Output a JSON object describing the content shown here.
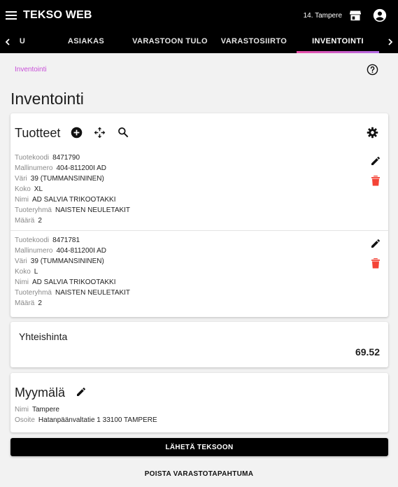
{
  "app": {
    "title": "TEKSO WEB",
    "store_name": "14. Tampere",
    "icons": {
      "menu": "menu-icon",
      "store": "storefront-icon",
      "account": "account-circle-icon"
    }
  },
  "tabs": {
    "partial": "U",
    "items": [
      {
        "label": "ASIAKAS",
        "active": false
      },
      {
        "label": "VARASTOON TULO",
        "active": false
      },
      {
        "label": "VARASTOSIIRTO",
        "active": false
      },
      {
        "label": "INVENTOINTI",
        "active": true
      }
    ]
  },
  "breadcrumb": "Inventointi",
  "page_title": "Inventointi",
  "products": {
    "title": "Tuotteet",
    "icons": [
      "add-circle-icon",
      "move-icon",
      "search-icon",
      "settings-icon"
    ],
    "items": [
      {
        "code_label": "Tuotekoodi",
        "code": "8471790",
        "model_label": "Mallinumero",
        "model": "404-811200I AD",
        "color_label": "Väri",
        "color": "39 (TUMMANSININEN)",
        "size_label": "Koko",
        "size": "XL",
        "name_label": "Nimi",
        "name": "AD SALVIA TRIKOOTAKKI",
        "group_label": "Tuoteryhmä",
        "group": "NAISTEN NEULETAKIT",
        "qty_label": "Määrä",
        "qty": "2"
      },
      {
        "code_label": "Tuotekoodi",
        "code": "8471781",
        "model_label": "Mallinumero",
        "model": "404-811200I AD",
        "color_label": "Väri",
        "color": "39 (TUMMANSININEN)",
        "size_label": "Koko",
        "size": "L",
        "name_label": "Nimi",
        "name": "AD SALVIA TRIKOOTAKKI",
        "group_label": "Tuoteryhmä",
        "group": "NAISTEN NEULETAKIT",
        "qty_label": "Määrä",
        "qty": "2"
      }
    ]
  },
  "total": {
    "label": "Yhteishinta",
    "value": "69.52"
  },
  "store": {
    "title": "Myymälä",
    "name_label": "Nimi",
    "name": "Tampere",
    "address_label": "Osoite",
    "address": "Hatanpäänvaltatie 1 33100 TAMPERE"
  },
  "actions": {
    "send": "LÄHETÄ TEKSOON",
    "delete": "POISTA VARASTOTAPAHTUMA"
  },
  "colors": {
    "accent_pink": "#e84ea7",
    "accent_purple": "#b36be5",
    "delete_red": "#f44336",
    "breadcrumb": "#c84fd8"
  }
}
